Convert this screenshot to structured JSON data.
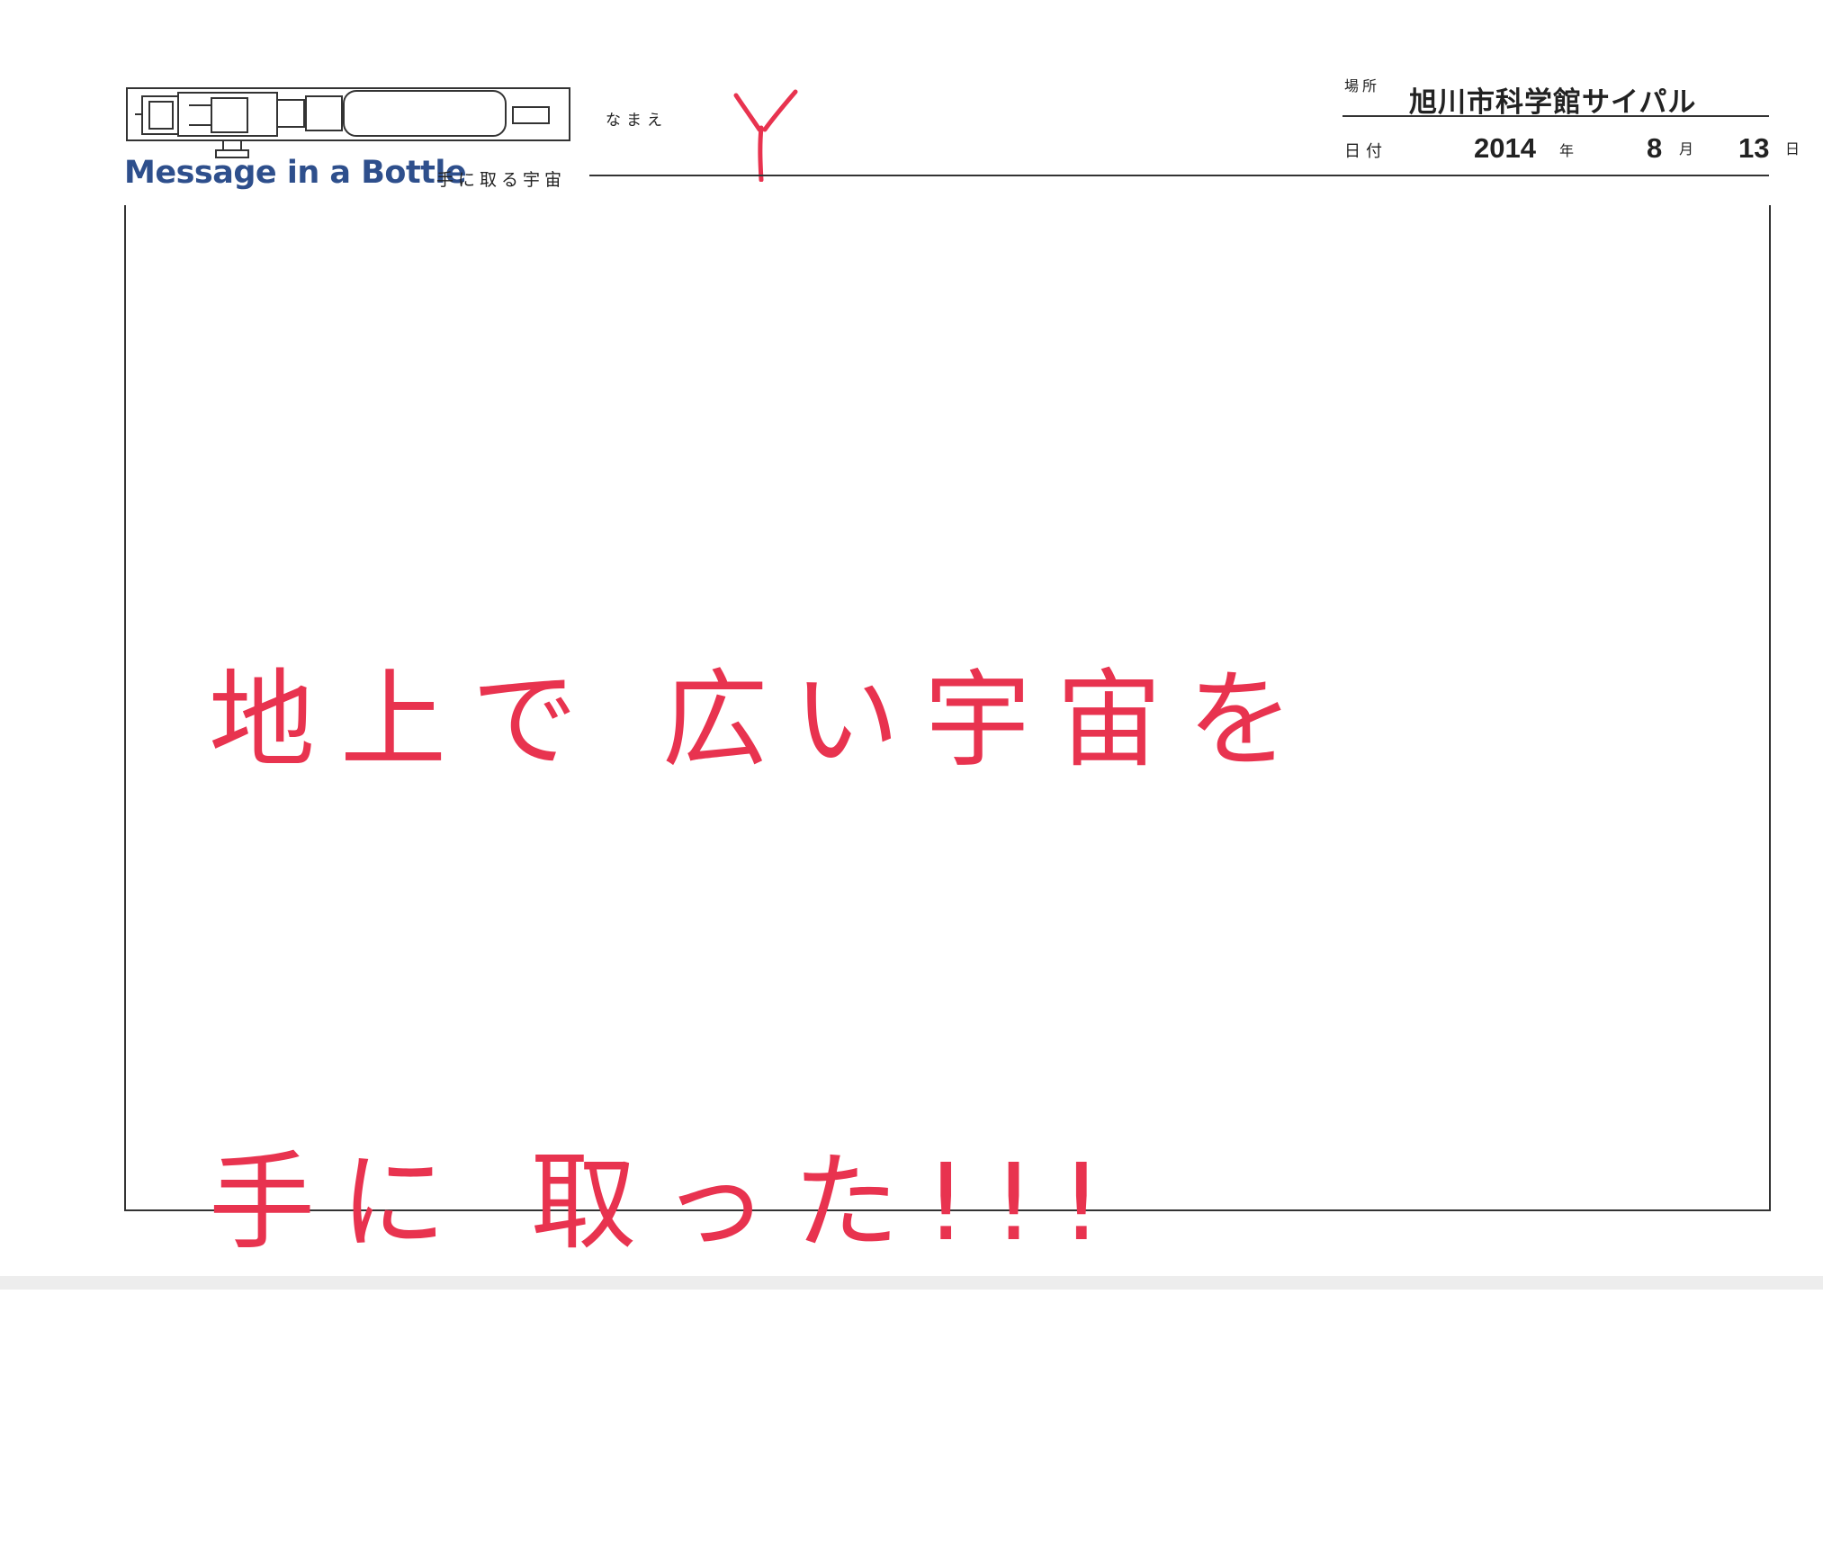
{
  "header": {
    "brand_title": "Message in a Bottle",
    "brand_subtitle": "手に取る宇宙",
    "name_label": "なまえ",
    "name_value": "Y",
    "place_label": "場所",
    "place_value": "旭川市科学館サイパル",
    "date_label": "日付",
    "date": {
      "year": "2014",
      "year_unit": "年",
      "month": "8",
      "month_unit": "月",
      "day": "13",
      "day_unit": "日"
    }
  },
  "message": {
    "lines": [
      "地上で 広い宇宙を",
      "手に 取った!!!"
    ]
  },
  "colors": {
    "brand": "#2e4f8c",
    "handwriting": "#e8334f",
    "rule": "#333333"
  },
  "icons": {
    "logo": "bottle-capsule-icon"
  }
}
